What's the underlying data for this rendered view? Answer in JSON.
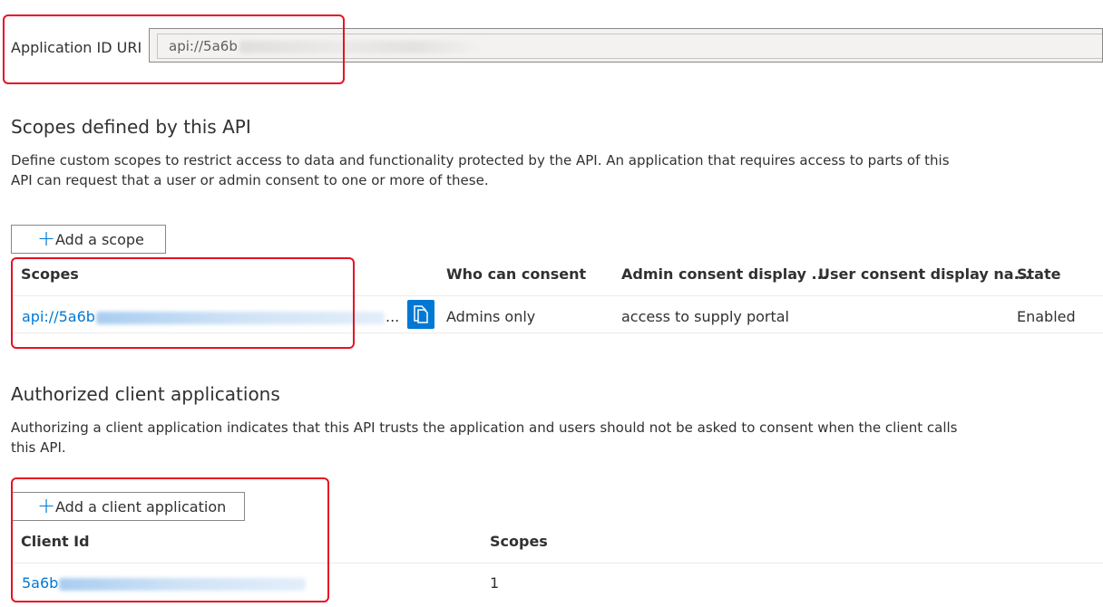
{
  "app_id": {
    "label": "Application ID URI",
    "value_prefix": "api://5a6b"
  },
  "scopes_section": {
    "title": "Scopes defined by this API",
    "description_line1": "Define custom scopes to restrict access to data and functionality protected by the API. An application that requires access to parts of this",
    "description_line2": "API can request that a user or admin consent to one or more of these.",
    "add_button": "Add a scope",
    "columns": [
      "Scopes",
      "Who can consent",
      "Admin consent display ...",
      "User consent display na...",
      "State"
    ],
    "rows": [
      {
        "scope_prefix": "api://5a6b",
        "ellipsis": "...",
        "who_can_consent": "Admins only",
        "admin_consent_display": "access to supply portal",
        "user_consent_display": "",
        "state": "Enabled"
      }
    ]
  },
  "clients_section": {
    "title": "Authorized client applications",
    "description_line1": "Authorizing a client application indicates that this API trusts the application and users should not be asked to consent when the client calls",
    "description_line2": "this API.",
    "add_button": "Add a client application",
    "columns": [
      "Client Id",
      "Scopes"
    ],
    "rows": [
      {
        "client_id_prefix": "5a6b",
        "scopes": "1"
      }
    ]
  },
  "icons": {
    "add": "plus-icon",
    "copy": "copy-icon"
  },
  "colors": {
    "accent": "#0078d4",
    "highlight": "#e81123"
  }
}
